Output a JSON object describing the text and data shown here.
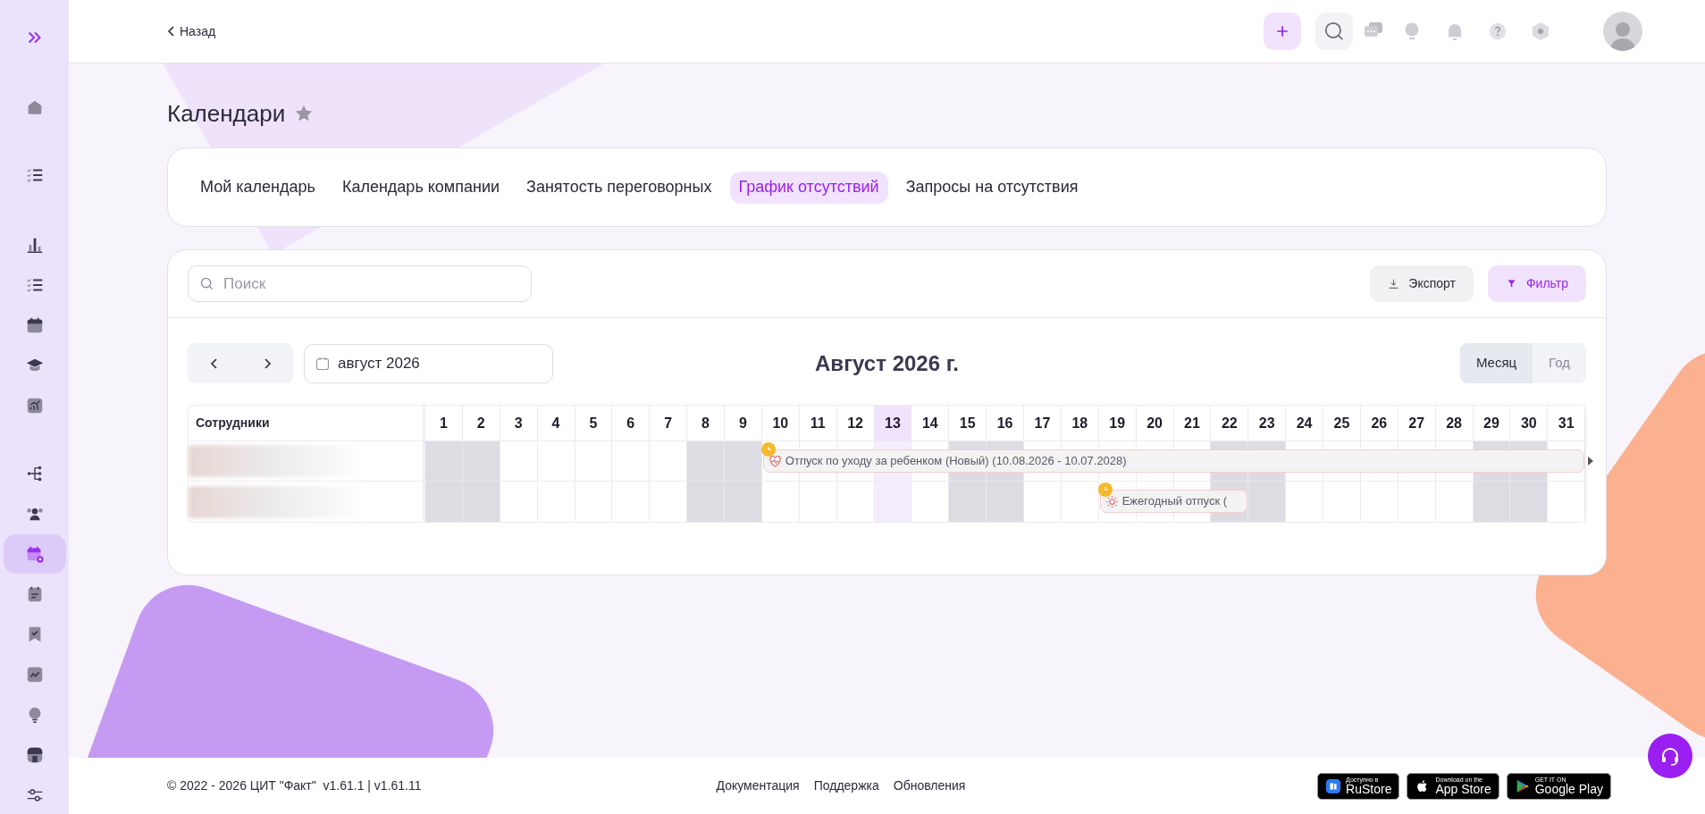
{
  "sidebar": {
    "groups": [
      [
        {
          "kind": "expand",
          "selected": false
        }
      ],
      [
        {
          "kind": "home",
          "selected": false
        }
      ],
      [
        {
          "kind": "checklist",
          "selected": false
        }
      ],
      [
        {
          "kind": "chart",
          "selected": false
        },
        {
          "kind": "checklist",
          "selected": false
        },
        {
          "kind": "calendar",
          "selected": false
        },
        {
          "kind": "cap",
          "selected": false
        },
        {
          "kind": "growth",
          "selected": false
        }
      ],
      [
        {
          "kind": "tree",
          "selected": false
        },
        {
          "kind": "people",
          "selected": false
        },
        {
          "kind": "calendar-badge",
          "selected": true
        },
        {
          "kind": "notes",
          "selected": false
        },
        {
          "kind": "bookmark",
          "selected": false
        },
        {
          "kind": "trend",
          "selected": false
        },
        {
          "kind": "bulb",
          "selected": false
        },
        {
          "kind": "store",
          "selected": false
        },
        {
          "kind": "sliders",
          "selected": false
        }
      ]
    ]
  },
  "top_bar": {
    "back_link": "Назад",
    "actions": [
      {
        "kind": "add"
      },
      {
        "kind": "search"
      },
      {
        "kind": "chat"
      },
      {
        "kind": "bulb"
      },
      {
        "kind": "bell"
      },
      {
        "kind": "help"
      },
      {
        "kind": "hexagon"
      }
    ]
  },
  "page": {
    "title": "Календари",
    "favorite": false
  },
  "tabs": [
    {
      "label": "Мой календарь",
      "selected": false
    },
    {
      "label": "Календарь компании",
      "selected": false
    },
    {
      "label": "Занятость переговорных",
      "selected": false
    },
    {
      "label": "График отсутствий",
      "selected": true
    },
    {
      "label": "Запросы на отсутствия",
      "selected": false
    }
  ],
  "toolbar": {
    "search": {
      "placeholder": "Поиск"
    },
    "buttons": [
      {
        "kind": "export",
        "label": "Экспорт"
      },
      {
        "kind": "filter",
        "label": "Фильтр"
      }
    ]
  },
  "period": {
    "date_field": "август 2026",
    "title": "Август 2026 г.",
    "views": [
      {
        "label": "Месяц",
        "selected": true
      },
      {
        "label": "Год",
        "selected": false
      }
    ]
  },
  "grid": {
    "employees_header": "Сотрудники",
    "days": [
      {
        "label": "1",
        "weekend": true,
        "today": false
      },
      {
        "label": "2",
        "weekend": true,
        "today": false
      },
      {
        "label": "3",
        "weekend": false,
        "today": false
      },
      {
        "label": "4",
        "weekend": false,
        "today": false
      },
      {
        "label": "5",
        "weekend": false,
        "today": false
      },
      {
        "label": "6",
        "weekend": false,
        "today": false
      },
      {
        "label": "7",
        "weekend": false,
        "today": false
      },
      {
        "label": "8",
        "weekend": true,
        "today": false
      },
      {
        "label": "9",
        "weekend": true,
        "today": false
      },
      {
        "label": "10",
        "weekend": false,
        "today": false
      },
      {
        "label": "11",
        "weekend": false,
        "today": false
      },
      {
        "label": "12",
        "weekend": false,
        "today": false
      },
      {
        "label": "13",
        "weekend": false,
        "today": true
      },
      {
        "label": "14",
        "weekend": false,
        "today": false
      },
      {
        "label": "15",
        "weekend": true,
        "today": false
      },
      {
        "label": "16",
        "weekend": true,
        "today": false
      },
      {
        "label": "17",
        "weekend": false,
        "today": false
      },
      {
        "label": "18",
        "weekend": false,
        "today": false
      },
      {
        "label": "19",
        "weekend": false,
        "today": false
      },
      {
        "label": "20",
        "weekend": false,
        "today": false
      },
      {
        "label": "21",
        "weekend": false,
        "today": false
      },
      {
        "label": "22",
        "weekend": true,
        "today": false
      },
      {
        "label": "23",
        "weekend": true,
        "today": false
      },
      {
        "label": "24",
        "weekend": false,
        "today": false
      },
      {
        "label": "25",
        "weekend": false,
        "today": false
      },
      {
        "label": "26",
        "weekend": false,
        "today": false
      },
      {
        "label": "27",
        "weekend": false,
        "today": false
      },
      {
        "label": "28",
        "weekend": false,
        "today": false
      },
      {
        "label": "29",
        "weekend": true,
        "today": false
      },
      {
        "label": "30",
        "weekend": true,
        "today": false
      },
      {
        "label": "31",
        "weekend": false,
        "today": false
      }
    ],
    "rows": [
      {
        "events": [
          {
            "kind": "parental",
            "label": "Отпуск по уходу за ребенком (Новый) (10.08.2026 - 10.07.2028)",
            "pending": true,
            "continues": true
          }
        ]
      },
      {
        "events": [
          {
            "kind": "vacation",
            "label": "Ежегодный отпуск (",
            "pending": true,
            "continues": false
          }
        ]
      }
    ]
  },
  "footer": {
    "copyright": "© 2022 - 2026 ЦИТ \"Факт\"  v1.61.1 | v1.61.11",
    "links": [
      "Документация",
      "Поддержка",
      "Обновления"
    ],
    "badges": [
      {
        "kind": "rustore",
        "small": "Доступно в",
        "big": "RuStore"
      },
      {
        "kind": "appstore",
        "small": "Download on the",
        "big": "App Store"
      },
      {
        "kind": "googleplay",
        "small": "GET IT ON",
        "big": "Google Play"
      }
    ]
  }
}
